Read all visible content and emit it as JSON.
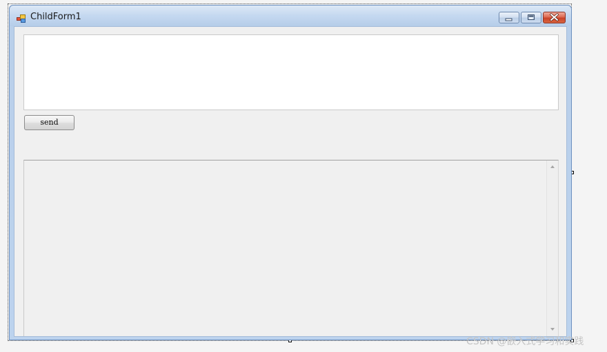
{
  "window": {
    "title": "ChildForm1",
    "icon": "form-icon"
  },
  "caption_buttons": {
    "minimize_icon": "minimize-icon",
    "maximize_icon": "maximize-icon",
    "close_icon": "close-icon",
    "close_color": "#c9432a"
  },
  "form": {
    "input_text": "",
    "send_label": "send",
    "output_text": ""
  },
  "watermark": {
    "text": "CSDN @嵌入式学习和实践"
  },
  "colors": {
    "title_bar": "#c4d8f0",
    "client_background": "#f0f0f0",
    "input_background": "#ffffff"
  }
}
